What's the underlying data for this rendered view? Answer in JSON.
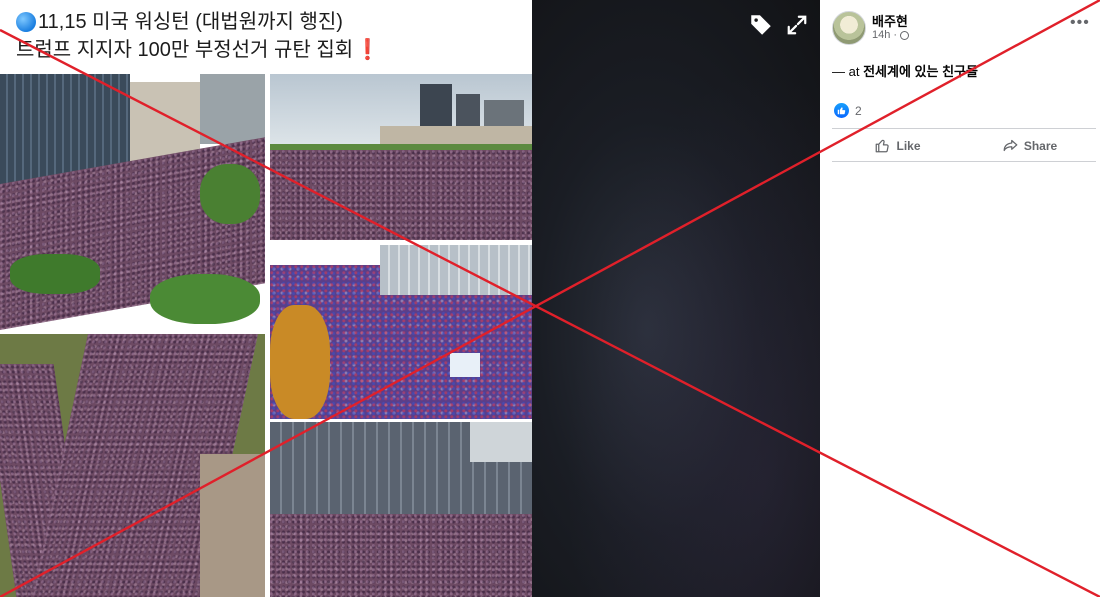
{
  "photo": {
    "caption_line1": "11,15 미국 워싱턴 (대법원까지 행진)",
    "caption_line2": "트럼프 지지자 100만 부정선거 규탄 집회",
    "caption_emoji_left": "blue-circle-icon",
    "caption_emoji_right": "red-exclamation-icon",
    "exclamation": "❗"
  },
  "viewer": {
    "tag_icon": "tag-icon",
    "expand_icon": "expand-icon"
  },
  "post": {
    "author": "배주현",
    "time": "14h",
    "audience_icon": "globe-icon",
    "more_label": "•••",
    "text_prefix": "— at",
    "location": "전세계에 있는 친구들",
    "reaction_count": "2",
    "actions": [
      {
        "label": "Like",
        "icon": "like-icon"
      },
      {
        "label": "Share",
        "icon": "share-icon"
      }
    ]
  },
  "overlay": {
    "cross_color": "#e0202a",
    "meaning": "red-x-overlay"
  },
  "colors": {
    "accent_blue": "#0866ff",
    "secondary_text": "#65676b"
  }
}
